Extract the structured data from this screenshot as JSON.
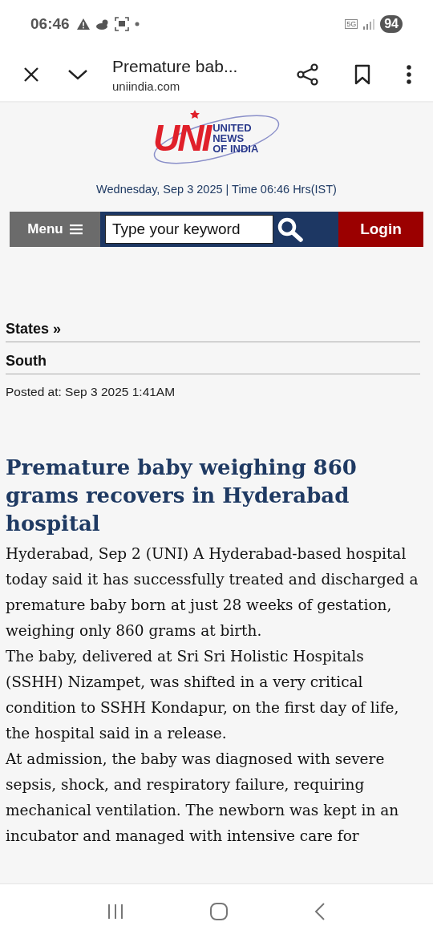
{
  "status_bar": {
    "time": "06:46",
    "battery": "94",
    "network": "5G"
  },
  "browser_toolbar": {
    "title": "Premature bab...",
    "url": "uniindia.com"
  },
  "site_header": {
    "logo_mark": "UNI",
    "logo_text": [
      "UNITED",
      "NEWS",
      "OF INDIA"
    ],
    "date_line": "Wednesday, Sep 3 2025 | Time 06:46 Hrs(IST)"
  },
  "nav_bar": {
    "menu": "Menu",
    "search": {
      "placeholder": "Type your keyword"
    },
    "login": "Login"
  },
  "breadcrumbs": [
    "States »",
    "South"
  ],
  "posted": "Posted at: Sep 3 2025 1:41AM",
  "article": {
    "title": "Premature baby weighing 860 grams recovers in Hyderabad hospital",
    "paragraphs": [
      "Hyderabad, Sep 2 (UNI) A Hyderabad-based hospital today said it has successfully treated and discharged a premature baby born at just 28 weeks of gestation, weighing only 860 grams at birth.",
      "The baby, delivered at Sri Sri Holistic Hospitals (SSHH) Nizampet, was shifted in a very critical condition to SSHH Kondapur, on the first day of life, the hospital said in a release.",
      "At admission, the baby was diagnosed with severe sepsis, shock, and respiratory failure, requiring mechanical ventilation. The newborn was kept in an incubator and managed with intensive care for"
    ]
  }
}
